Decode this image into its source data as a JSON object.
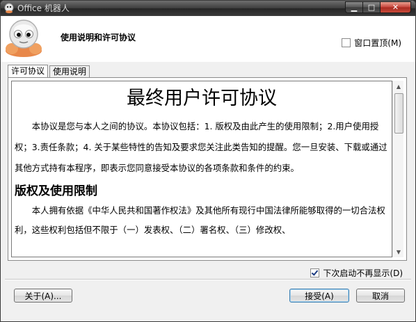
{
  "window": {
    "title": "Office 机器人",
    "minimize_glyph": "▁",
    "maximize_glyph": "□",
    "close_glyph": "✕"
  },
  "header": {
    "title": "使用说明和许可协议",
    "always_on_top_label": "窗口置顶(M)",
    "always_on_top_checked": false
  },
  "tabs": [
    {
      "label": "许可协议",
      "active": true
    },
    {
      "label": "使用说明",
      "active": false
    }
  ],
  "document": {
    "title": "最终用户许可协议",
    "paragraph1": "本协议是您与本人之间的协议。本协议包括：1. 版权及由此产生的使用限制；2.用户使用授权；3.责任条款；4. 关于某些特性的告知及要求您关注此类告知的提醒。您一旦安装、下载或通过其他方式持有本程序，即表示您同意接受本协议的各项条款和条件的约束。",
    "section1": "版权及使用限制",
    "paragraph2": "本人拥有依据《中华人民共和国著作权法》及其他所有现行中国法律所能够取得的一切合法权利，这些权利包括但不限于（一）发表权、（二）署名权、（三）修改权、"
  },
  "footer": {
    "dont_show_label": "下次启动不再显示(D)",
    "dont_show_checked": true,
    "about_label": "关于(A)...",
    "accept_label": "接受(A)",
    "cancel_label": "取消"
  }
}
